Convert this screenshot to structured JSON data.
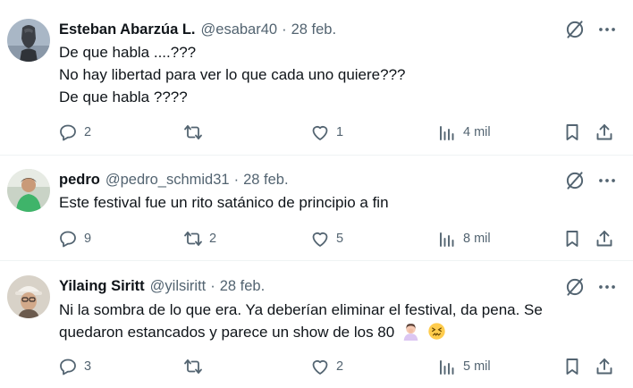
{
  "tweets": [
    {
      "name": "Esteban Abarzúa L.",
      "handle": "@esabar40",
      "separator": "·",
      "date": "28 feb.",
      "lines": [
        "De que habla ....???",
        "No hay libertad para ver lo que cada uno quiere???",
        "De que habla ????"
      ],
      "replies": "2",
      "reposts": "",
      "likes": "1",
      "views": "4 mil",
      "avatar_icon": "statue-avatar-icon"
    },
    {
      "name": "pedro",
      "handle": "@pedro_schmid31",
      "separator": "·",
      "date": "28 feb.",
      "lines": [
        "Este festival fue un rito satánico de principio a fin"
      ],
      "replies": "9",
      "reposts": "2",
      "likes": "5",
      "views": "8 mil",
      "avatar_icon": "person-green-shirt-avatar-icon"
    },
    {
      "name": "Yilaing Siritt",
      "handle": "@yilsiritt",
      "separator": "·",
      "date": "28 feb.",
      "lines": [
        "Ni la sombra de lo que era. Ya deberían eliminar el festival, da pena. Se",
        "quedaron estancados y parece un show de los 80"
      ],
      "emojis": [
        "person-facepalming-emoji",
        "confounded-face-emoji"
      ],
      "replies": "3",
      "reposts": "",
      "likes": "2",
      "views": "5 mil",
      "avatar_icon": "woman-with-cap-avatar-icon"
    }
  ],
  "colors": {
    "text": "#0f1419",
    "secondary": "#536471",
    "divider": "#eff3f4"
  }
}
